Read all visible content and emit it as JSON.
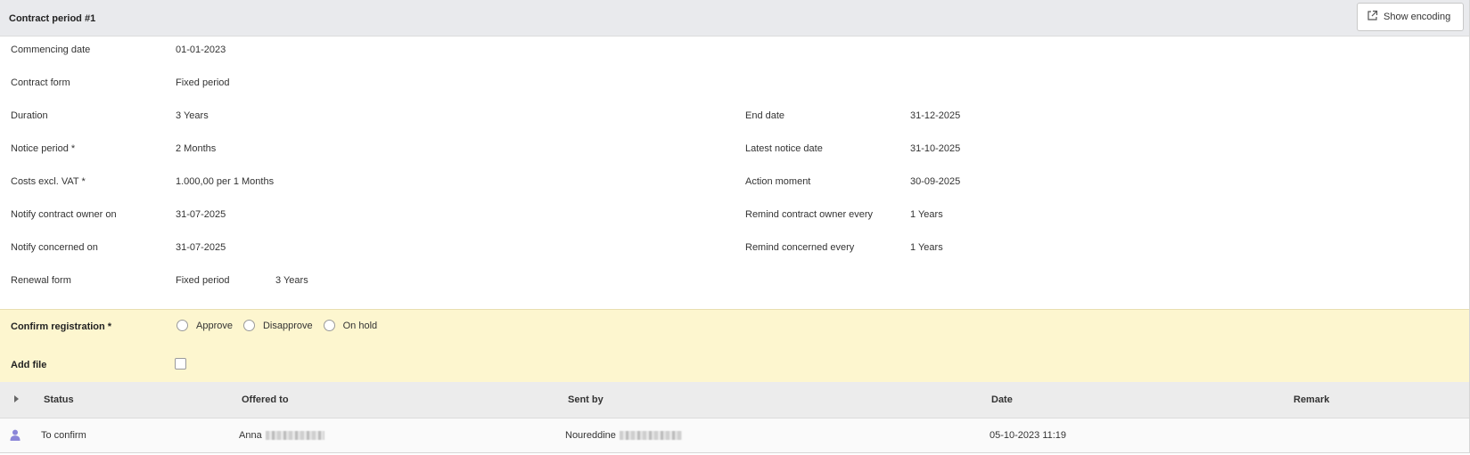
{
  "header": {
    "title": "Contract period #1",
    "show_encoding_label": "Show encoding"
  },
  "fields_left": [
    {
      "label": "Commencing date",
      "value": "01-01-2023"
    },
    {
      "label": "Contract form",
      "value": "Fixed period"
    },
    {
      "label": "Duration",
      "value": "3 Years"
    },
    {
      "label": "Notice period *",
      "value": "2 Months"
    },
    {
      "label": "Costs excl. VAT *",
      "value": "1.000,00 per 1 Months"
    },
    {
      "label": "Notify contract owner on",
      "value": "31-07-2025"
    },
    {
      "label": "Notify concerned on",
      "value": "31-07-2025"
    },
    {
      "label": "Renewal form",
      "value": "Fixed period",
      "extra": "3 Years"
    }
  ],
  "fields_right": [
    {
      "label": "End date",
      "value": "31-12-2025"
    },
    {
      "label": "Latest notice date",
      "value": "31-10-2025"
    },
    {
      "label": "Action moment",
      "value": "30-09-2025"
    },
    {
      "label": "Remind contract owner every",
      "value": "1 Years"
    },
    {
      "label": "Remind concerned every",
      "value": "1 Years"
    }
  ],
  "confirm": {
    "label": "Confirm registration *",
    "options": [
      "Approve",
      "Disapprove",
      "On hold"
    ],
    "add_file_label": "Add file"
  },
  "table": {
    "columns": [
      "Status",
      "Offered to",
      "Sent by",
      "Date",
      "Remark"
    ],
    "rows": [
      {
        "status": "To confirm",
        "offered_to": "Anna",
        "sent_by": "Noureddine",
        "date": "05-10-2023 11:19",
        "remark": ""
      }
    ]
  }
}
